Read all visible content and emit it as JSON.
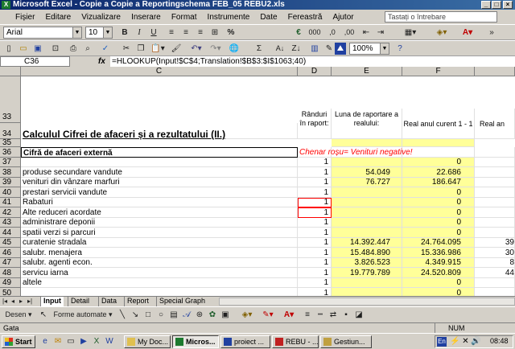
{
  "window": {
    "title": "Microsoft Excel - Copie a Copie a Reportingschema FEB_05 REBU2.xls",
    "app_icon": "X"
  },
  "menu": [
    "Fișier",
    "Editare",
    "Vizualizare",
    "Inserare",
    "Format",
    "Instrumente",
    "Date",
    "Fereastră",
    "Ajutor"
  ],
  "ask": {
    "placeholder": "Tastați o întrebare"
  },
  "format_toolbar": {
    "font": "Arial",
    "size": "10",
    "bold": "B",
    "italic": "I",
    "underline": "U",
    "currency": "%",
    "euro": "€",
    "thousands": "000",
    "dec_inc": ",0",
    "dec_dec": ",00"
  },
  "std_toolbar": {
    "zoom": "100%",
    "sigma": "Σ",
    "sort": "A↓"
  },
  "formula_bar": {
    "name_box": "C36",
    "fx": "fx",
    "formula": "=HLOOKUP(Input!$C$4;Translation!$B$3:$I$1063;40)"
  },
  "columns": [
    "C",
    "D",
    "E",
    "F"
  ],
  "header_rows": {
    "r34_title": "Calculul Cifrei de afaceri și a rezultatului (II.)",
    "d_head": "Rânduri în raport:",
    "e_head": "Luna de raportare a realului:",
    "f_head": "Real anul curent 1 - 1",
    "g_head": "Real an"
  },
  "row_numbers": [
    "33",
    "34",
    "35",
    "36",
    "37",
    "38",
    "39",
    "40",
    "41",
    "42",
    "43",
    "44",
    "45",
    "46",
    "47",
    "48",
    "49",
    "50"
  ],
  "rows": [
    {
      "n": "36",
      "c": "Cifră de afaceri externă",
      "d": "",
      "e": "",
      "f": "",
      "g": "",
      "note": "Chenar roșu= Venituri negative!"
    },
    {
      "n": "37",
      "c": "",
      "d": "1",
      "e": "",
      "f": "0",
      "g": ""
    },
    {
      "n": "38",
      "c": "produse secundare vandute",
      "d": "1",
      "e": "54.049",
      "f": "22.686",
      "g": ""
    },
    {
      "n": "39",
      "c": "venituri din vânzare marfuri",
      "d": "1",
      "e": "76.727",
      "f": "186.647",
      "g": ""
    },
    {
      "n": "40",
      "c": "prestari servicii vandute",
      "d": "1",
      "e": "",
      "f": "0",
      "g": ""
    },
    {
      "n": "41",
      "c": "Rabaturi",
      "d": "1",
      "e": "",
      "f": "0",
      "g": ""
    },
    {
      "n": "42",
      "c": "Alte reduceri acordate",
      "d": "1",
      "e": "",
      "f": "0",
      "g": ""
    },
    {
      "n": "43",
      "c": "administrare deponii",
      "d": "1",
      "e": "",
      "f": "0",
      "g": ""
    },
    {
      "n": "44",
      "c": "spatii verzi si parcuri",
      "d": "1",
      "e": "",
      "f": "0",
      "g": ""
    },
    {
      "n": "45",
      "c": "curatenie stradala",
      "d": "1",
      "e": "14.392.447",
      "f": "24.764.095",
      "g": "39"
    },
    {
      "n": "46",
      "c": "salubr. menajera",
      "d": "1",
      "e": "15.484.890",
      "f": "15.336.986",
      "g": "30"
    },
    {
      "n": "47",
      "c": "salubr. agenti econ.",
      "d": "1",
      "e": "3.826.523",
      "f": "4.349.915",
      "g": "8"
    },
    {
      "n": "48",
      "c": "servicu iarna",
      "d": "1",
      "e": "19.779.789",
      "f": "24.520.809",
      "g": "44"
    },
    {
      "n": "49",
      "c": "altele",
      "d": "1",
      "e": "",
      "f": "0",
      "g": ""
    },
    {
      "n": "50",
      "c": "",
      "d": "1",
      "e": "",
      "f": "0",
      "g": ""
    }
  ],
  "sheet_tabs": [
    "Input",
    "Detail",
    "Data",
    "Report",
    "Special Graph"
  ],
  "draw_toolbar": {
    "draw": "Desen ▾",
    "autoshapes": "Forme automate ▾"
  },
  "status": {
    "left": "Gata",
    "num": "NUM"
  },
  "taskbar": {
    "start": "Start",
    "tasks": [
      "My Doc...",
      "Micros...",
      "proiect ...",
      "REBU - ...",
      "Gestiun..."
    ],
    "lang": "En",
    "clock": "08:48"
  },
  "colors": {
    "highlight": "#ffff99",
    "note_red": "#ff0000",
    "title_blue": "#0a246a"
  }
}
